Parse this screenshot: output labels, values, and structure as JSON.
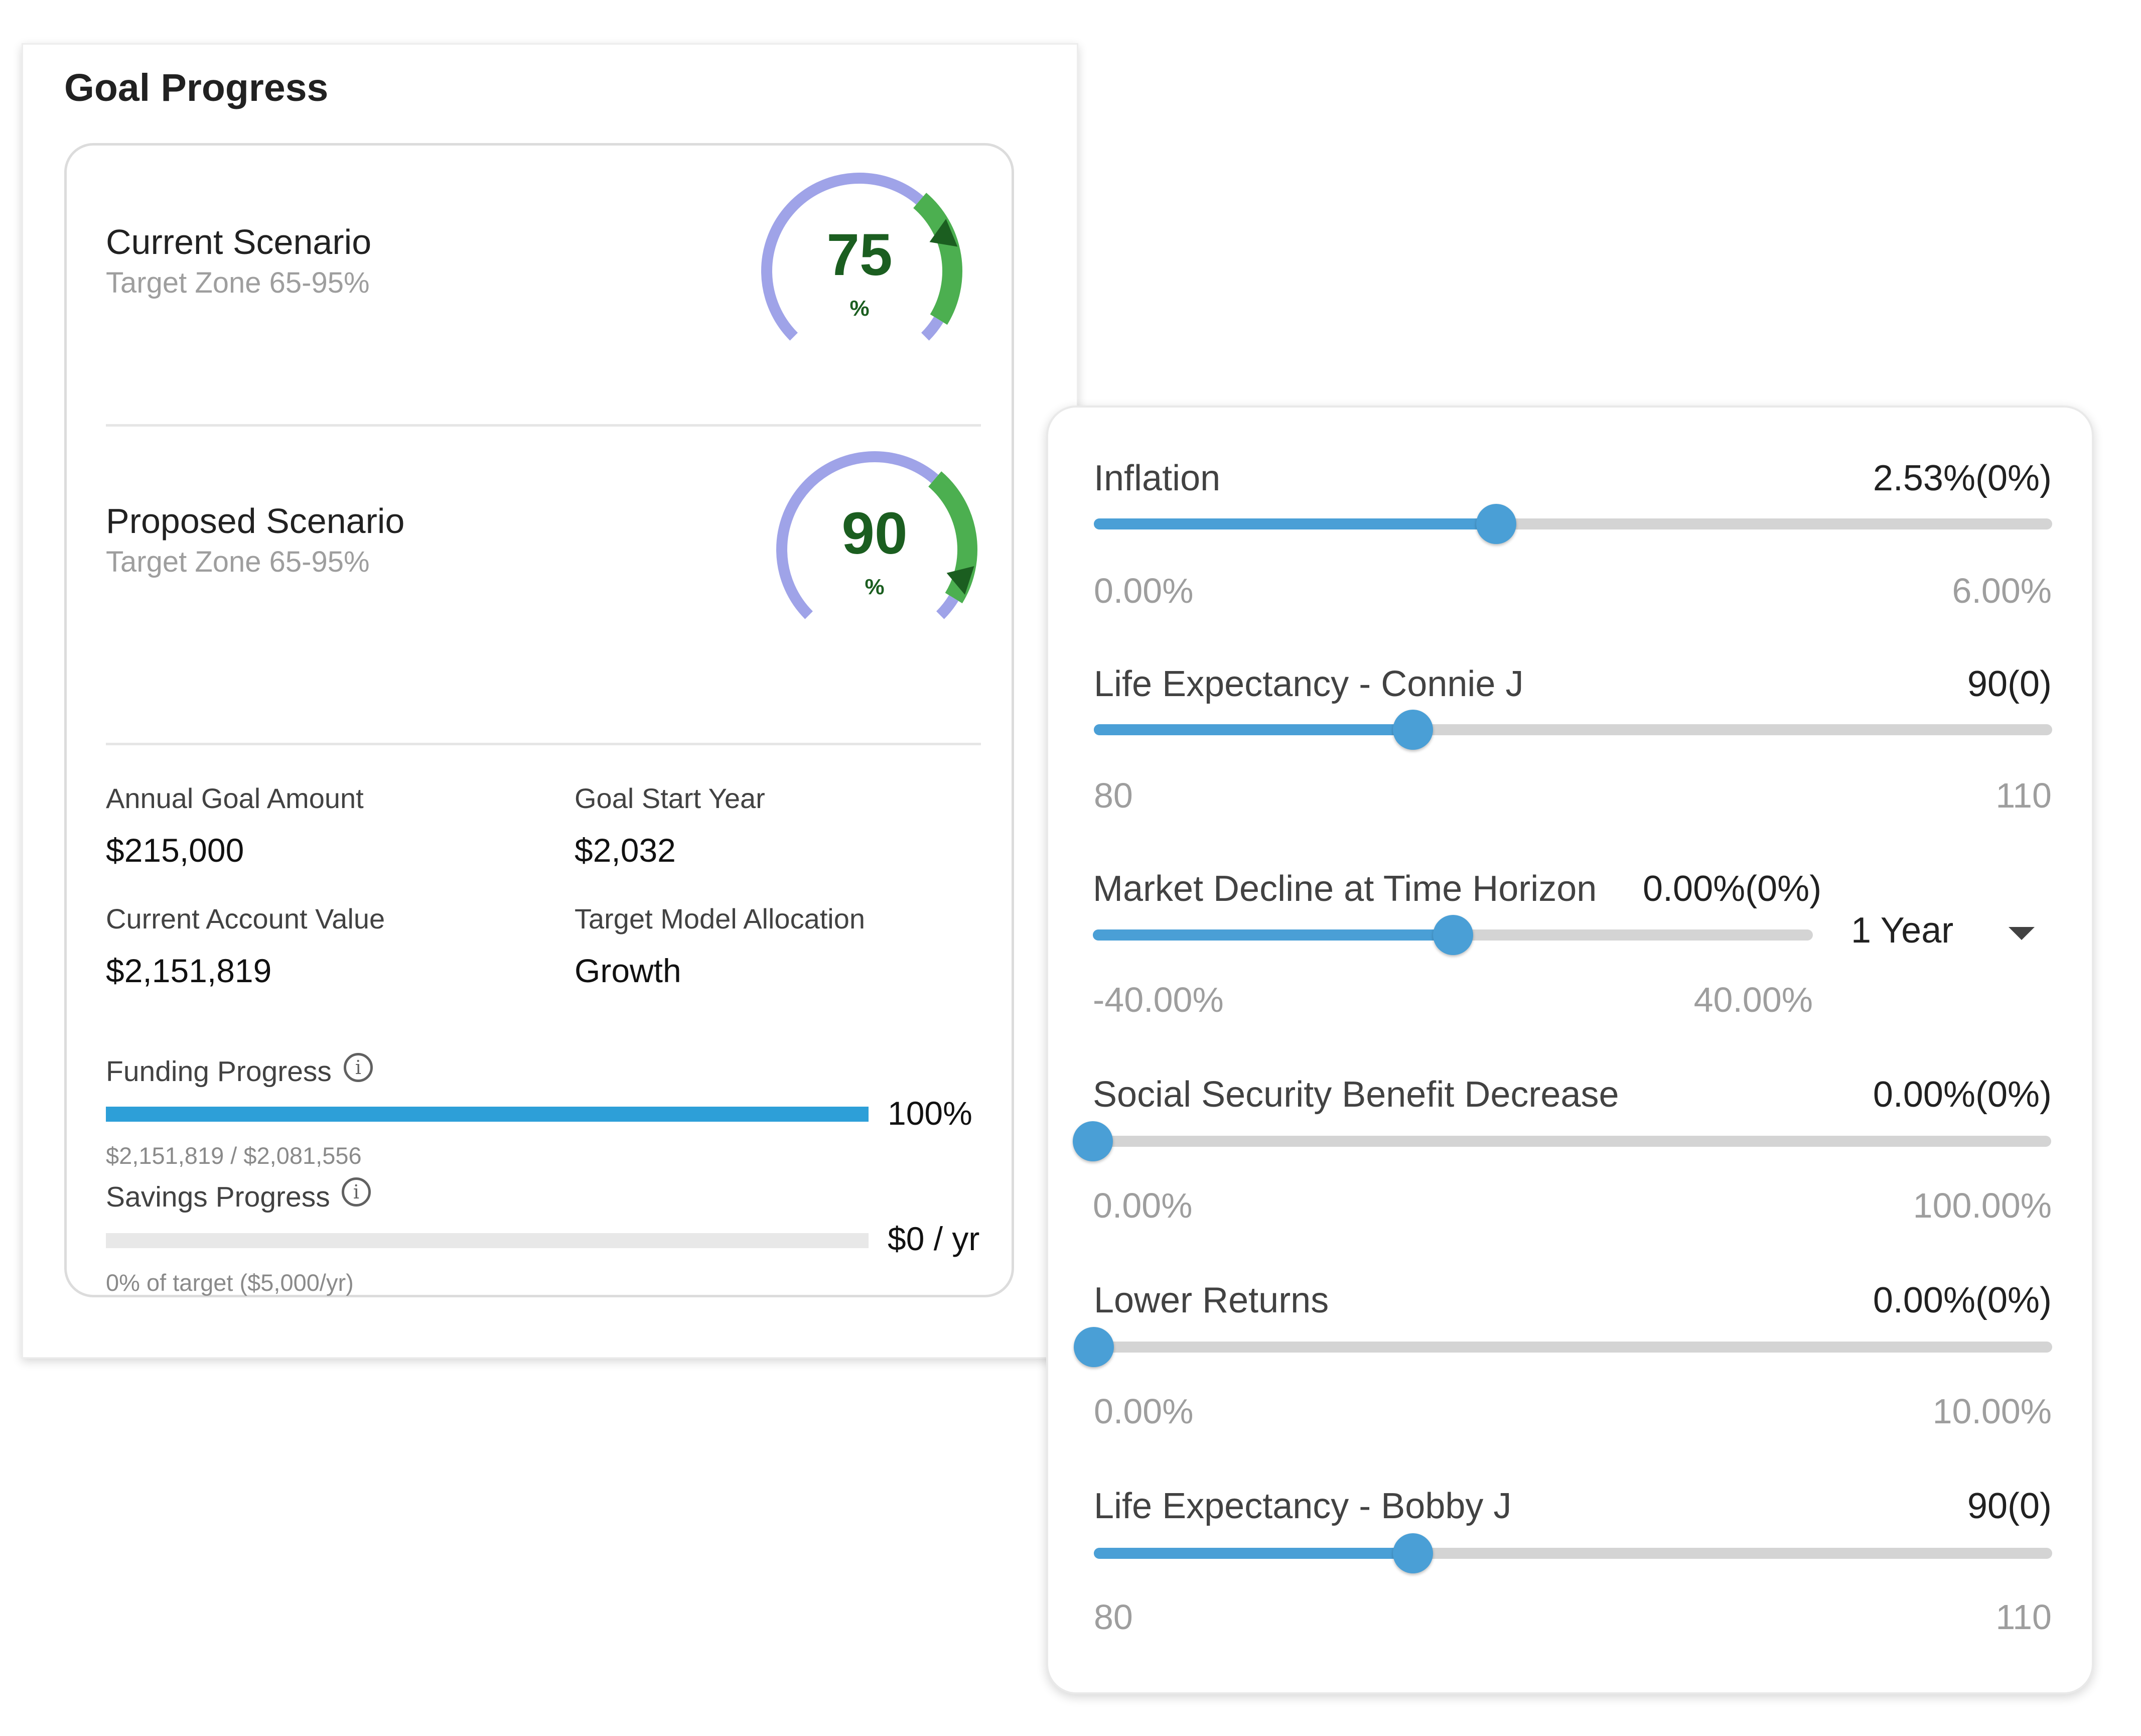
{
  "goal_progress": {
    "title": "Goal Progress",
    "current": {
      "title": "Current Scenario",
      "target_zone": "Target Zone 65-95%",
      "value": "75",
      "unit": "%"
    },
    "proposed": {
      "title": "Proposed Scenario",
      "target_zone": "Target Zone 65-95%",
      "value": "90",
      "unit": "%"
    },
    "details": {
      "annual_goal_amount": {
        "label": "Annual Goal Amount",
        "value": "$215,000"
      },
      "goal_start_year": {
        "label": "Goal Start Year",
        "value": "$2,032"
      },
      "current_account_value": {
        "label": "Current Account Value",
        "value": "$2,151,819"
      },
      "target_model_allocation": {
        "label": "Target Model Allocation",
        "value": "Growth"
      }
    },
    "funding": {
      "label": "Funding Progress",
      "value": "100%",
      "fraction": 1.0,
      "sub": "$2,151,819 / $2,081,556"
    },
    "savings": {
      "label": "Savings Progress",
      "value": "$0 / yr",
      "fraction": 0.0,
      "sub": "0% of target ($5,000/yr)"
    },
    "info_glyph": "i",
    "colors": {
      "gauge_track": "#9fa3e8",
      "gauge_zone": "#4caf50",
      "gauge_marker": "#1b5e20",
      "value_text": "#1b5e20",
      "progress_bar": "#2d9fd8"
    }
  },
  "assumptions": {
    "sliders": [
      {
        "label": "Inflation",
        "value": "2.53%(0%)",
        "min": "0.00%",
        "max": "6.00%",
        "position": 0.42
      },
      {
        "label": "Life Expectancy - Connie J",
        "value": "90(0)",
        "min": "80",
        "max": "110",
        "position": 0.333
      },
      {
        "label": "Market Decline at Time Horizon",
        "value": "0.00%(0%)",
        "min": "-40.00%",
        "max": "40.00%",
        "position": 0.5
      },
      {
        "label": "Social Security Benefit Decrease",
        "value": "0.00%(0%)",
        "min": "0.00%",
        "max": "100.00%",
        "position": 0.0
      },
      {
        "label": "Lower Returns",
        "value": "0.00%(0%)",
        "min": "0.00%",
        "max": "10.00%",
        "position": 0.0
      },
      {
        "label": "Life Expectancy - Bobby J",
        "value": "90(0)",
        "min": "80",
        "max": "110",
        "position": 0.333
      }
    ],
    "horizon_select": {
      "value": "1 Year",
      "icon": "chevron-down-icon"
    },
    "colors": {
      "slider_fill": "#4a9fd6",
      "slider_track": "#d4d4d4"
    }
  }
}
